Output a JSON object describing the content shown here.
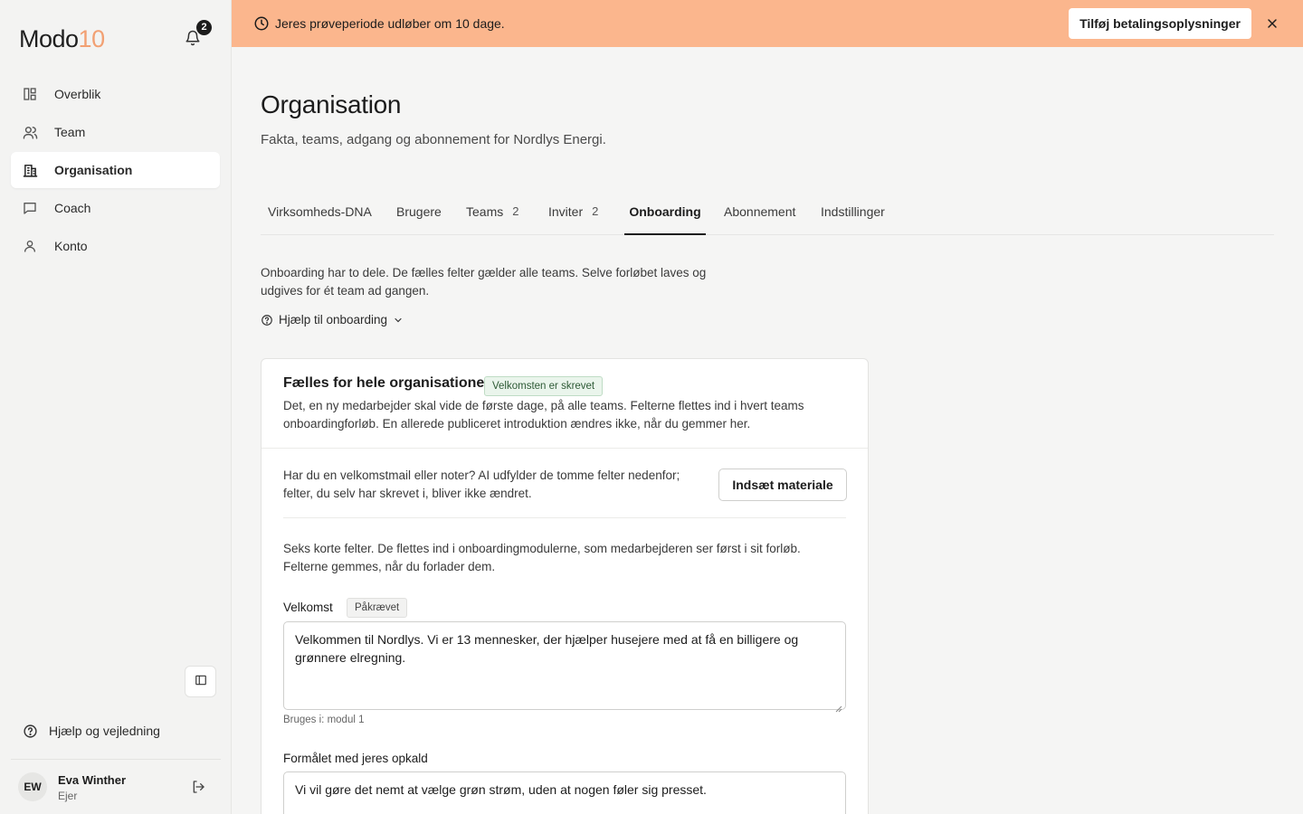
{
  "brand": {
    "logo_main": "Modo",
    "logo_accent": "10",
    "accent_color": "#f2a073"
  },
  "notifications": {
    "count": "2"
  },
  "sidebar": {
    "items": [
      {
        "label": "Overblik",
        "icon": "layout-icon"
      },
      {
        "label": "Team",
        "icon": "users-icon"
      },
      {
        "label": "Organisation",
        "icon": "building-icon",
        "active": true
      },
      {
        "label": "Coach",
        "icon": "chat-icon"
      },
      {
        "label": "Konto",
        "icon": "user-icon"
      }
    ],
    "help_label": "Hjælp og vejledning",
    "user": {
      "initials": "EW",
      "name": "Eva Winther",
      "role": "Ejer"
    }
  },
  "banner": {
    "text": "Jeres prøveperiode udløber om 10 dage.",
    "button_label": "Tilføj betalingsoplysninger",
    "color": "#fbb68d"
  },
  "page": {
    "title": "Organisation",
    "subtitle": "Fakta, teams, adgang og abonnement for Nordlys Energi."
  },
  "tabs": [
    {
      "label": "Virksomheds-DNA",
      "count": ""
    },
    {
      "label": "Brugere",
      "count": ""
    },
    {
      "label": "Teams",
      "count": "2"
    },
    {
      "label": "Inviter",
      "count": "2"
    },
    {
      "label": "Onboarding",
      "count": "",
      "active": true
    },
    {
      "label": "Abonnement",
      "count": ""
    },
    {
      "label": "Indstillinger",
      "count": ""
    }
  ],
  "onboarding": {
    "intro": "Onboarding har to dele. De fælles felter gælder alle teams. Selve forløbet laves og udgives for ét team ad gangen.",
    "help_toggle": "Hjælp til onboarding",
    "card": {
      "title": "Fælles for hele organisationen",
      "status_badge": "Velkomsten er skrevet",
      "description": "Det, en ny medarbejder skal vide de første dage, på alle teams. Felterne flettes ind i hvert teams onboardingforløb. En allerede publiceret introduktion ændres ikke, når du gemmer her.",
      "ai_text": "Har du en velkomstmail eller noter? AI udfylder de tomme felter nedenfor; felter, du selv har skrevet i, bliver ikke ændret.",
      "ai_button": "Indsæt materiale",
      "fields_description": "Seks korte felter. De flettes ind i onboardingmodulerne, som medarbejderen ser først i sit forløb. Felterne gemmes, når du forlader dem.",
      "fields": [
        {
          "label": "Velkomst",
          "required_badge": "Påkrævet",
          "value": "Velkommen til Nordlys. Vi er 13 mennesker, der hjælper husejere med at få en billigere og grønnere elregning.",
          "meta": "Bruges i: modul 1"
        },
        {
          "label": "Formålet med jeres opkald",
          "value": "Vi vil gøre det nemt at vælge grøn strøm, uden at nogen føler sig presset."
        }
      ]
    }
  }
}
